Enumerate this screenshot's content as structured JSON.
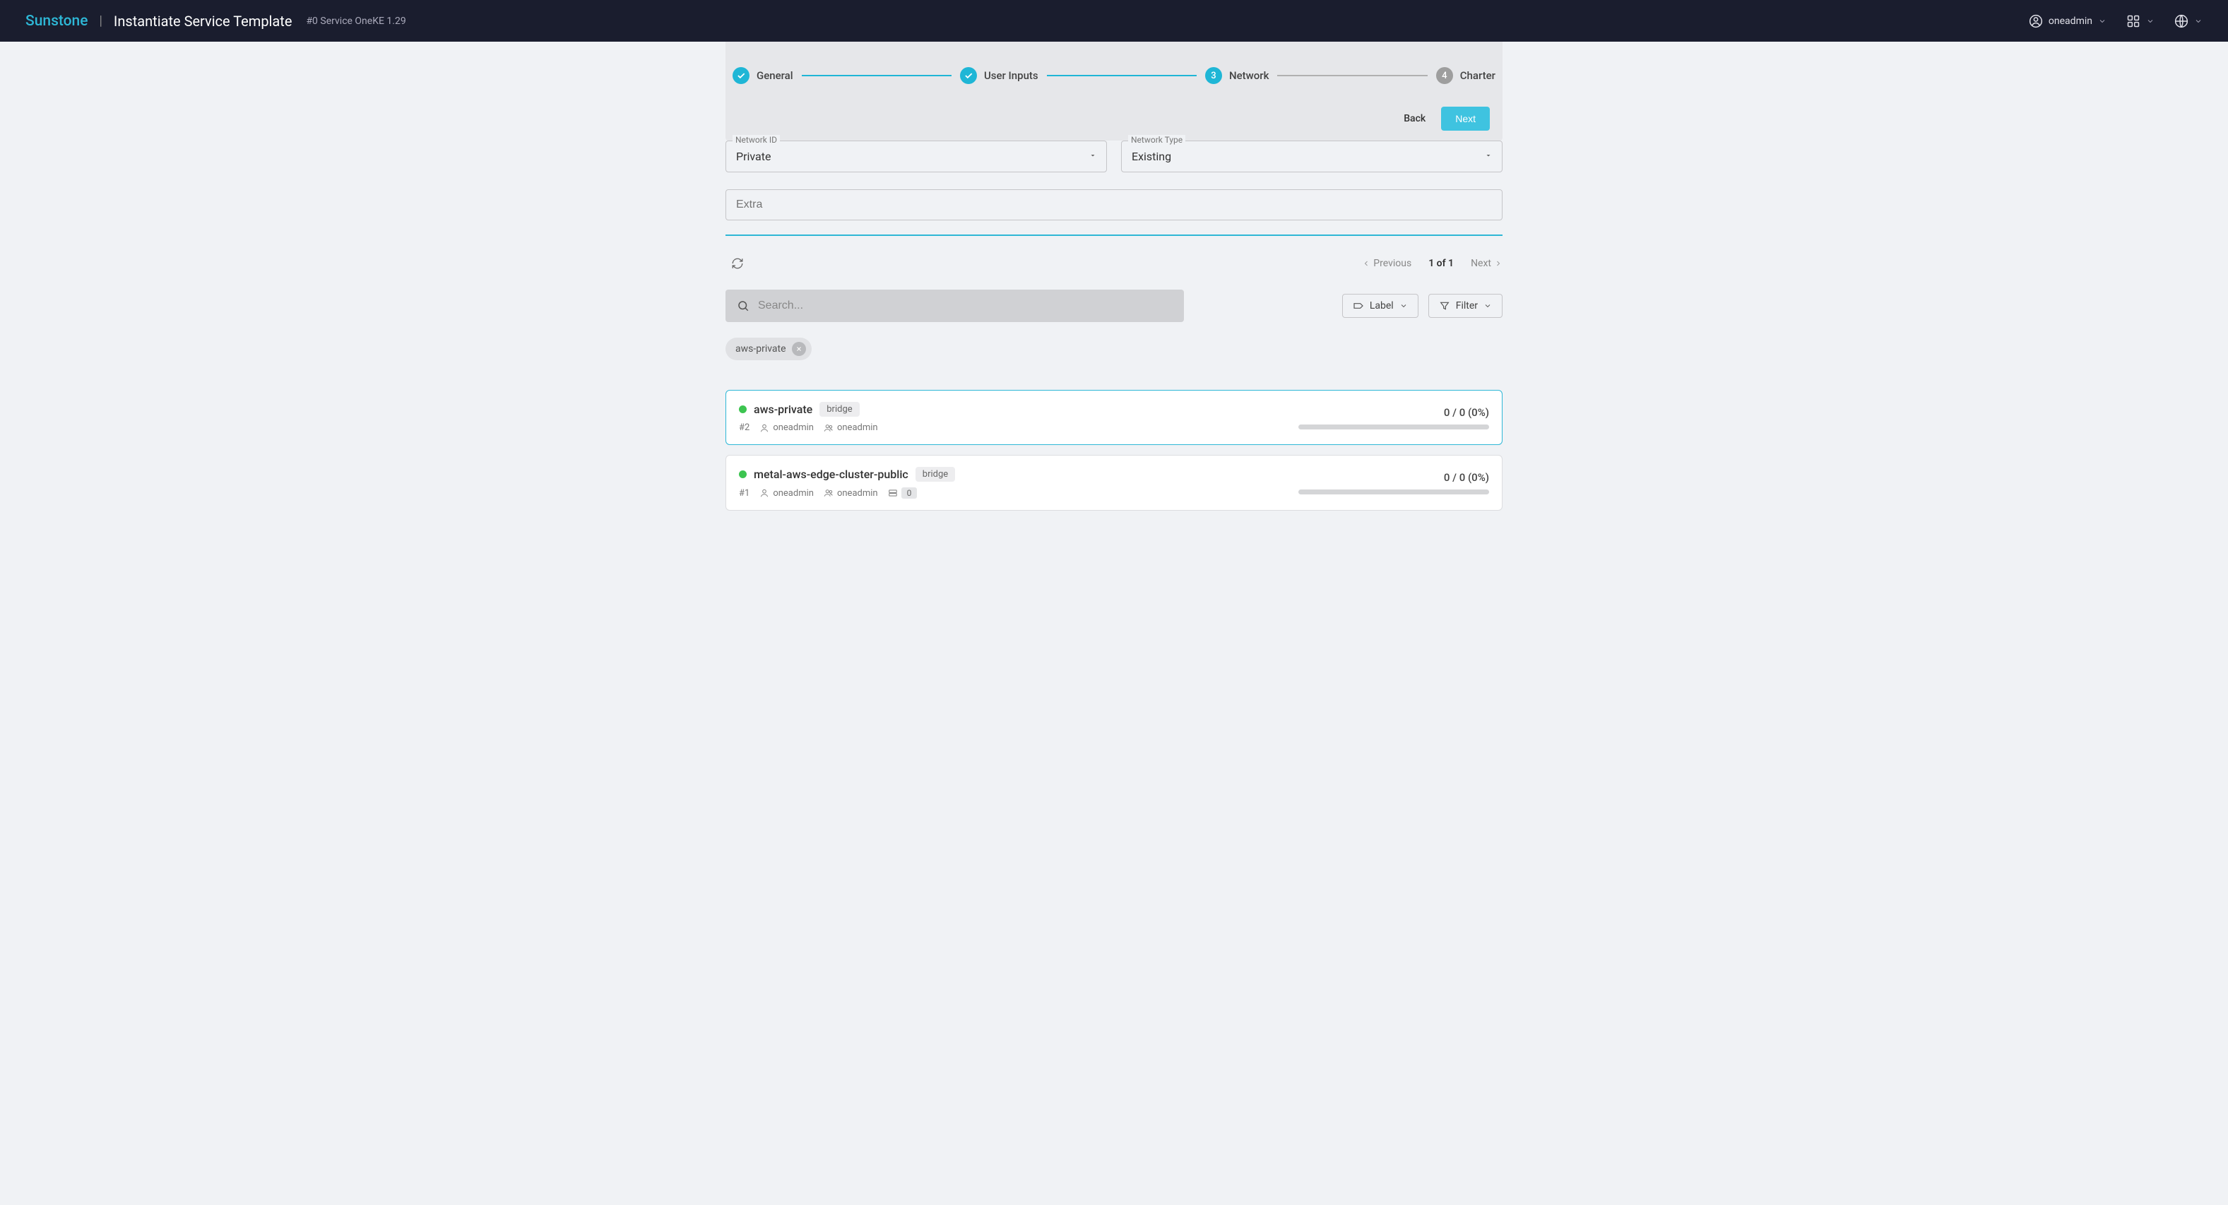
{
  "header": {
    "brand": "Sunstone",
    "page_title": "Instantiate Service Template",
    "page_subtitle": "#0 Service OneKE 1.29",
    "user": "oneadmin"
  },
  "stepper": {
    "steps": [
      {
        "label": "General",
        "state": "done"
      },
      {
        "label": "User Inputs",
        "state": "done"
      },
      {
        "label": "Network",
        "state": "active",
        "num": "3"
      },
      {
        "label": "Charter",
        "state": "inactive",
        "num": "4"
      }
    ],
    "back": "Back",
    "next": "Next"
  },
  "form": {
    "network_id": {
      "label": "Network ID",
      "value": "Private"
    },
    "network_type": {
      "label": "Network Type",
      "value": "Existing"
    },
    "extra_placeholder": "Extra"
  },
  "pager": {
    "previous": "Previous",
    "status": "1 of 1",
    "next": "Next"
  },
  "search": {
    "placeholder": "Search..."
  },
  "buttons": {
    "label": "Label",
    "filter": "Filter"
  },
  "chip": {
    "text": "aws-private"
  },
  "networks": [
    {
      "name": "aws-private",
      "badge": "bridge",
      "id": "#2",
      "owner": "oneadmin",
      "group": "oneadmin",
      "selected": true,
      "usage": "0 / 0 (0%)",
      "cluster_count": null
    },
    {
      "name": "metal-aws-edge-cluster-public",
      "badge": "bridge",
      "id": "#1",
      "owner": "oneadmin",
      "group": "oneadmin",
      "selected": false,
      "usage": "0 / 0 (0%)",
      "cluster_count": "0"
    }
  ]
}
